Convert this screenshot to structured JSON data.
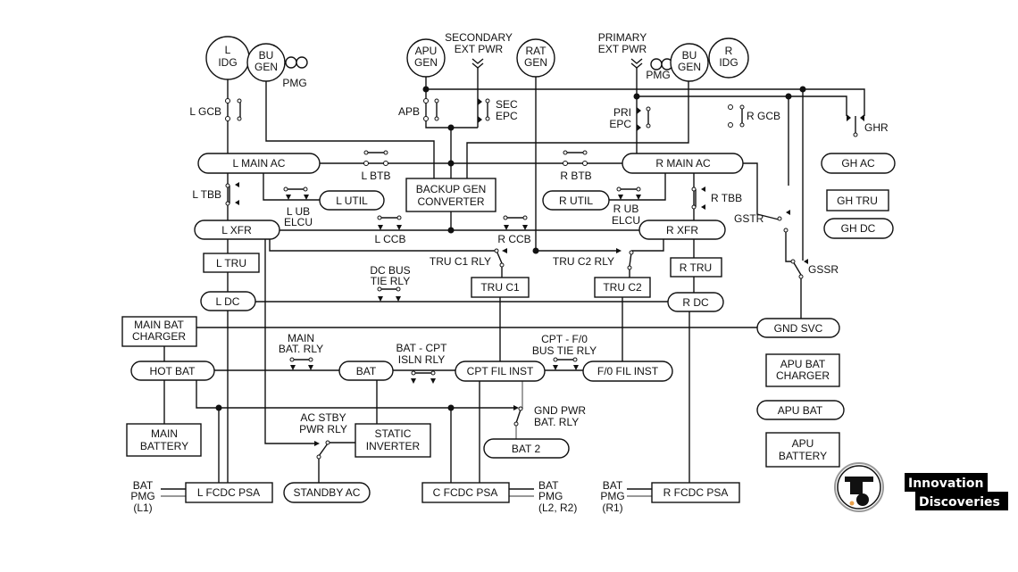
{
  "generators": {
    "l_idg": [
      "L",
      "IDG"
    ],
    "l_bu_gen": [
      "BU",
      "GEN"
    ],
    "l_pmg": "PMG",
    "apu_gen": [
      "APU",
      "GEN"
    ],
    "secondary_ext_pwr": [
      "SECONDARY",
      "EXT PWR"
    ],
    "rat_gen": [
      "RAT",
      "GEN"
    ],
    "primary_ext_pwr": [
      "PRIMARY",
      "EXT PWR"
    ],
    "r_pmg": "PMG",
    "r_bu_gen": [
      "BU",
      "GEN"
    ],
    "r_idg": [
      "R",
      "IDG"
    ]
  },
  "switches": {
    "l_gcb": "L GCB",
    "apb": "APB",
    "sec_epc": [
      "SEC",
      "EPC"
    ],
    "pri_epc": [
      "PRI",
      "EPC"
    ],
    "r_gcb": "R GCB",
    "ghr": "GHR",
    "l_btb": "L BTB",
    "r_btb": "R BTB",
    "l_tbb": "L TBB",
    "r_tbb": "R TBB",
    "l_ub_elcu": [
      "L UB",
      "ELCU"
    ],
    "r_ub_elcu": [
      "R UB",
      "ELCU"
    ],
    "l_ccb": "L CCB",
    "r_ccb": "R CCB",
    "tru_c1_rly": "TRU C1 RLY",
    "tru_c2_rly": "TRU C2 RLY",
    "gstr": "GSTR",
    "gssr": "GSSR",
    "dc_bus_tie_rly": [
      "DC BUS",
      "TIE RLY"
    ],
    "main_bat_rly": [
      "MAIN",
      "BAT. RLY"
    ],
    "bat_cpt_isln_rly": [
      "BAT - CPT",
      "ISLN RLY"
    ],
    "cpt_fo_bus_tie_rly": [
      "CPT - F/0",
      "BUS TIE RLY"
    ],
    "gnd_pwr_bat_rly": [
      "GND PWR",
      "BAT. RLY"
    ],
    "ac_stby_pwr_rly": [
      "AC STBY",
      "PWR RLY"
    ]
  },
  "buses": {
    "l_main_ac": "L MAIN AC",
    "r_main_ac": "R MAIN AC",
    "l_util": "L UTIL",
    "r_util": "R UTIL",
    "l_xfr": "L XFR",
    "r_xfr": "R XFR",
    "gh_ac": "GH AC",
    "gh_dc": "GH DC",
    "l_dc": "L DC",
    "r_dc": "R DC",
    "gnd_svc": "GND SVC",
    "hot_bat": "HOT BAT",
    "bat": "BAT",
    "cpt_fil_inst": "CPT FIL INST",
    "fo_fil_inst": "F/0 FIL INST",
    "bat_2": "BAT 2",
    "standby_ac": "STANDBY AC",
    "apu_bat": "APU BAT"
  },
  "boxes": {
    "backup_gen_converter": [
      "BACKUP GEN",
      "CONVERTER"
    ],
    "gh_tru": "GH TRU",
    "l_tru": "L TRU",
    "r_tru": "R TRU",
    "tru_c1": "TRU C1",
    "tru_c2": "TRU C2",
    "main_bat_charger": [
      "MAIN BAT",
      "CHARGER"
    ],
    "main_battery": [
      "MAIN",
      "BATTERY"
    ],
    "static_inverter": [
      "STATIC",
      "INVERTER"
    ],
    "l_fcdc_psa": "L FCDC PSA",
    "c_fcdc_psa": "C FCDC PSA",
    "r_fcdc_psa": "R FCDC PSA",
    "apu_bat_charger": [
      "APU BAT",
      "CHARGER"
    ],
    "apu_battery": [
      "APU",
      "BATTERY"
    ]
  },
  "psa_inputs": {
    "l": [
      "BAT",
      "PMG",
      "(L1)"
    ],
    "c": [
      "BAT",
      "PMG",
      "(L2, R2)"
    ],
    "r": [
      "BAT",
      "PMG",
      "(R1)"
    ]
  },
  "logo": {
    "line1": "Innovation",
    "line2": "Discoveries"
  },
  "colors": {
    "line": "#111111",
    "pmg_line": "#777777",
    "background": "#ffffff"
  }
}
